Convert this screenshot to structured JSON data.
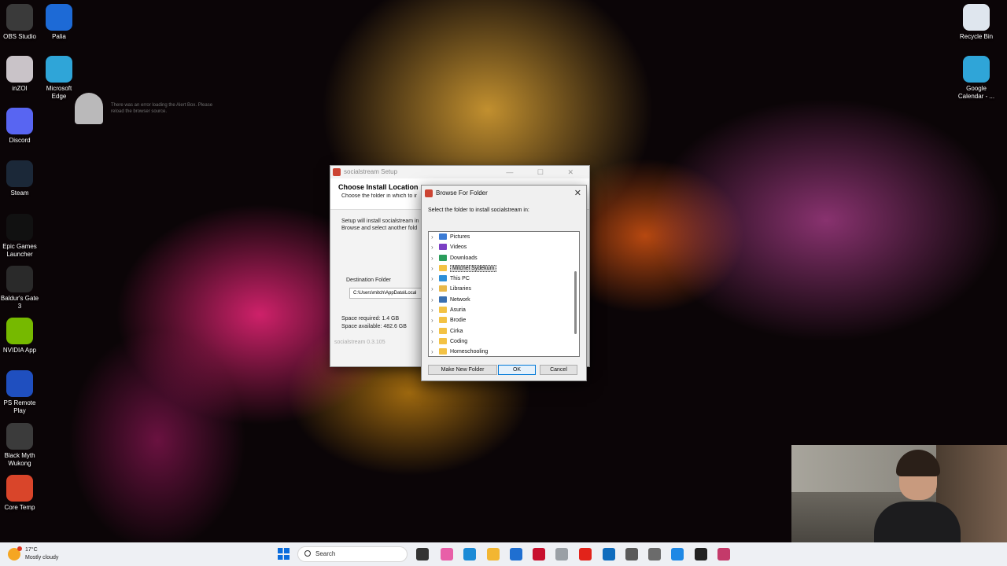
{
  "desktop": {
    "left_icons": [
      {
        "label": "OBS Studio",
        "icon": "obs-icon",
        "color": "#3a3a3a"
      },
      {
        "label": "inZOI",
        "icon": "inzoi-icon",
        "color": "#c9c3c8"
      },
      {
        "label": "Discord",
        "icon": "discord-icon",
        "color": "#5865f2"
      },
      {
        "label": "Steam",
        "icon": "steam-icon",
        "color": "#1b2838"
      },
      {
        "label": "Epic Games Launcher",
        "icon": "epic-games-icon",
        "color": "#111111"
      },
      {
        "label": "Baldur's Gate 3",
        "icon": "baldurs-gate-icon",
        "color": "#2a2a2a"
      },
      {
        "label": "NVIDIA App",
        "icon": "nvidia-icon",
        "color": "#76b900"
      },
      {
        "label": "PS Remote Play",
        "icon": "ps-remote-play-icon",
        "color": "#1f4fbf"
      },
      {
        "label": "Black Myth Wukong",
        "icon": "black-myth-icon",
        "color": "#3b3b3b"
      },
      {
        "label": "Core Temp",
        "icon": "core-temp-icon",
        "color": "#d9452a"
      }
    ],
    "second_col_icons": [
      {
        "label": "Palia",
        "icon": "palia-icon",
        "color": "#1d6ad6"
      },
      {
        "label": "Microsoft Edge",
        "icon": "edge-icon",
        "color": "#2fa5d8"
      }
    ],
    "right_icons": [
      {
        "label": "Recycle Bin",
        "icon": "recycle-bin-icon",
        "color": "#dfe6ee"
      },
      {
        "label": "Google Calendar - ...",
        "icon": "edge-icon",
        "color": "#2fa5d8"
      }
    ],
    "ghost_text": "There was an error loading the Alert Box. Please reload the browser source."
  },
  "setup_window": {
    "title": "socialstream Setup",
    "header_title": "Choose Install Location",
    "header_subtitle": "Choose the folder in which to install socialstream",
    "body_text": "Setup will install socialstream in the following folder. To install in a different folder, click Browse and select another folder.",
    "body_line1": "Setup will install socialstream in",
    "body_line2": "Browse and select another fold",
    "dest_label": "Destination Folder",
    "dest_path": "C:\\Users\\mitch\\AppData\\Local",
    "space_required": "Space required: 1.4 GB",
    "space_available": "Space available: 482.6 GB",
    "version": "socialstream 0.3.105"
  },
  "browse_dialog": {
    "title": "Browse For Folder",
    "instruction": "Select the folder to install socialstream in:",
    "tree_items": [
      {
        "label": "Pictures",
        "icon": "pictures-folder-icon",
        "color": "#3a7bd5",
        "selected": false
      },
      {
        "label": "Videos",
        "icon": "videos-folder-icon",
        "color": "#7b3fc4",
        "selected": false
      },
      {
        "label": "Downloads",
        "icon": "downloads-folder-icon",
        "color": "#2a9d5c",
        "selected": false
      },
      {
        "label": "Mitchel Sydekum",
        "icon": "user-folder-icon",
        "color": "#f3c244",
        "selected": true
      },
      {
        "label": "This PC",
        "icon": "this-pc-icon",
        "color": "#2d8fd8",
        "selected": false
      },
      {
        "label": "Libraries",
        "icon": "libraries-icon",
        "color": "#e8b84a",
        "selected": false
      },
      {
        "label": "Network",
        "icon": "network-icon",
        "color": "#3a6fb0",
        "selected": false
      },
      {
        "label": "Asuria",
        "icon": "folder-icon",
        "color": "#f3c244",
        "selected": false
      },
      {
        "label": "Brodie",
        "icon": "folder-icon",
        "color": "#f3c244",
        "selected": false
      },
      {
        "label": "Cirka",
        "icon": "folder-icon",
        "color": "#f3c244",
        "selected": false
      },
      {
        "label": "Coding",
        "icon": "folder-icon",
        "color": "#f3c244",
        "selected": false
      },
      {
        "label": "Homeschooling",
        "icon": "folder-icon",
        "color": "#f3c244",
        "selected": false
      }
    ],
    "make_new_folder": "Make New Folder",
    "ok": "OK",
    "cancel": "Cancel"
  },
  "taskbar": {
    "weather_temp": "17°C",
    "weather_desc": "Mostly cloudy",
    "search_label": "Search",
    "apps": [
      {
        "icon": "task-view-icon",
        "color": "#333333"
      },
      {
        "icon": "copilot-icon",
        "color": "#e85fa8"
      },
      {
        "icon": "edge-icon",
        "color": "#1c8bd6"
      },
      {
        "icon": "file-explorer-icon",
        "color": "#f2b632"
      },
      {
        "icon": "microsoft-store-icon",
        "color": "#1f6fd1"
      },
      {
        "icon": "mcafee-icon",
        "color": "#c8102e"
      },
      {
        "icon": "settings-icon",
        "color": "#9aa0a6"
      },
      {
        "icon": "lenovo-icon",
        "color": "#e2231a"
      },
      {
        "icon": "outlook-icon",
        "color": "#0f6cbd"
      },
      {
        "icon": "devices-icon",
        "color": "#5a5a5a"
      },
      {
        "icon": "calculator-icon",
        "color": "#6b6b6b"
      },
      {
        "icon": "photos-icon",
        "color": "#1e88e5"
      },
      {
        "icon": "github-icon",
        "color": "#222222"
      },
      {
        "icon": "socialstream-icon",
        "color": "#c43a6a"
      }
    ]
  }
}
